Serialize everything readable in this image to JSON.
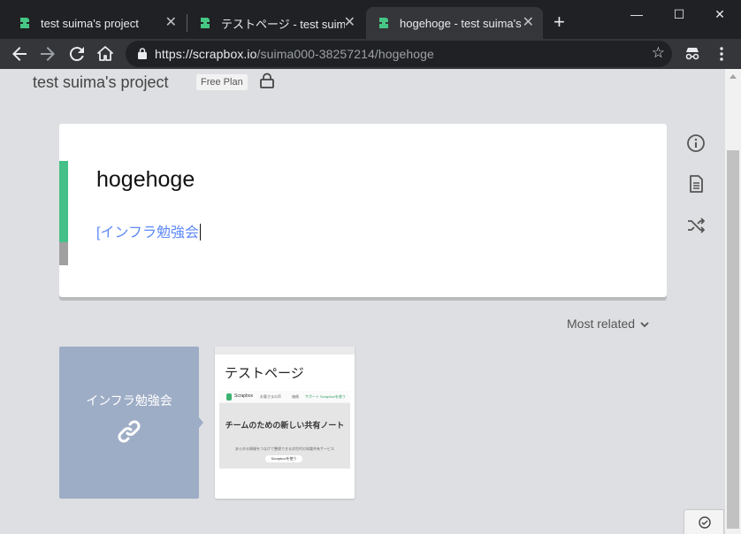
{
  "browser": {
    "tabs": [
      {
        "title": "test suima's project",
        "active": false
      },
      {
        "title": "テストページ - test suima's p",
        "active": false
      },
      {
        "title": "hogehoge - test suima's p",
        "active": true
      }
    ],
    "new_tab": "+",
    "url_host": "https://scrapbox.io",
    "url_path": "/suima000-38257214/hogehoge"
  },
  "project": {
    "name": "test suima's project",
    "plan": "Free Plan"
  },
  "page": {
    "title": "hogehoge",
    "link_text": "[インフラ勉強会"
  },
  "related": {
    "sort_label": "Most related",
    "link_card": {
      "title": "インフラ勉強会"
    },
    "page_card": {
      "title": "テストページ",
      "thumb": {
        "brand": "Scrapbox",
        "nav": [
          "お客さまの声",
          "価格",
          "サポート",
          "Scrapboxを使う"
        ],
        "headline": "チームのための新しい共有ノート",
        "subline": "あらゆる情報をつなげて整理できる次世代の知識共有サービス",
        "cta": "Scrapboxを使う"
      }
    }
  },
  "icons": {
    "side": [
      "info-icon",
      "document-icon",
      "shuffle-icon"
    ],
    "link": "link-icon",
    "float": "check-circle-icon"
  },
  "colors": {
    "accent_green": "#44c088",
    "link_blue": "#5e8af7",
    "card_blue": "#9eadc6",
    "background": "#dedfe2"
  }
}
